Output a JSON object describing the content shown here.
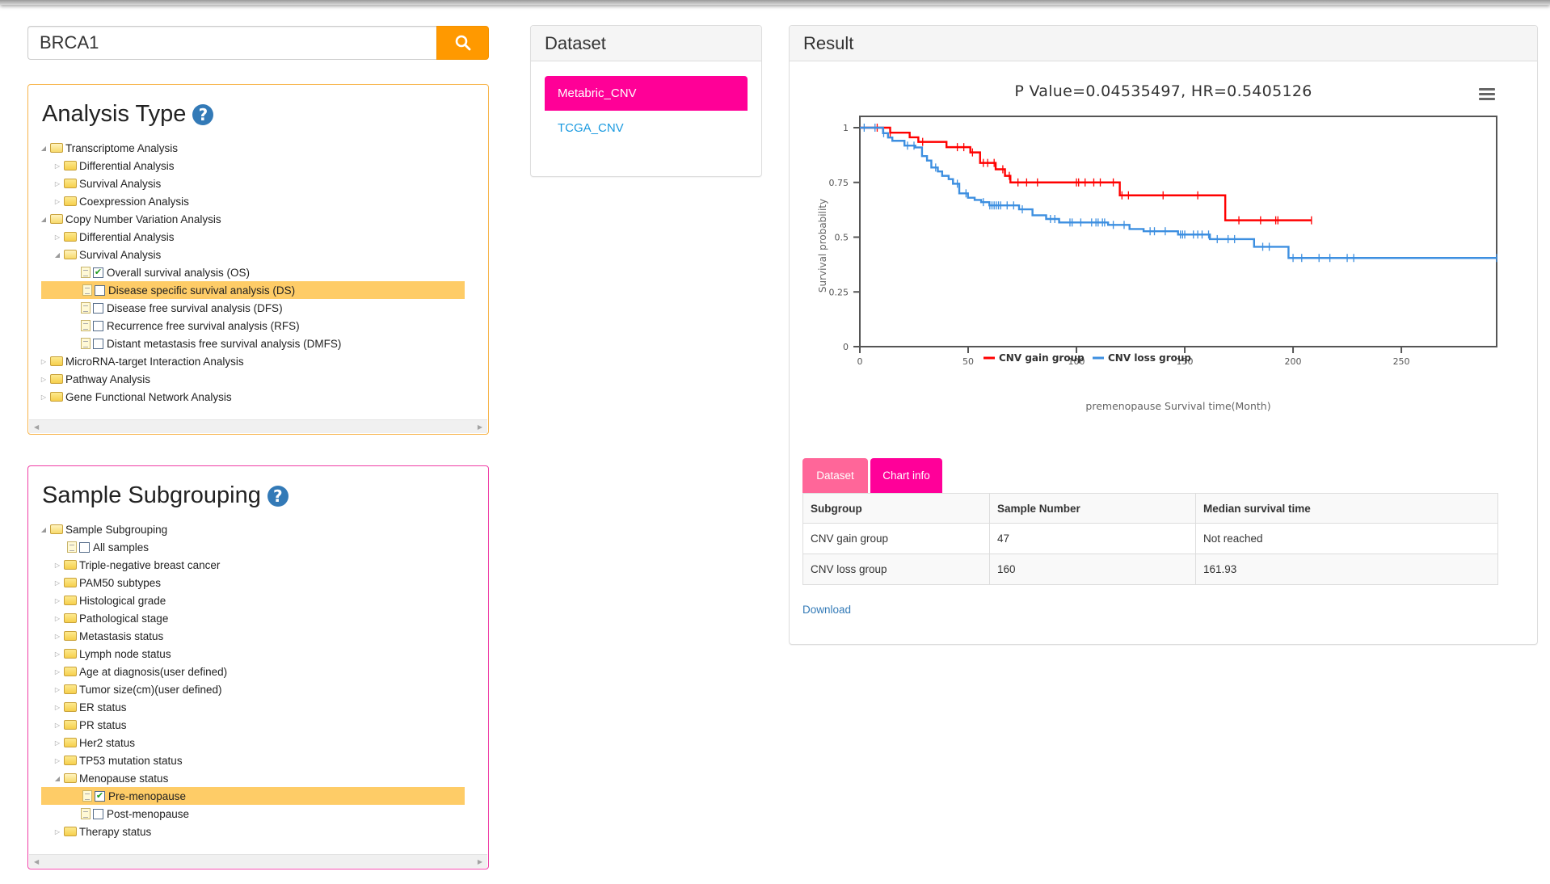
{
  "search": {
    "value": "BRCA1",
    "button_icon": "search-icon"
  },
  "analysis_panel": {
    "title": "Analysis Type",
    "help_icon": "?",
    "tree": [
      {
        "label": "Transcriptome Analysis",
        "level": 0,
        "type": "folder",
        "expanded": true
      },
      {
        "label": "Differential Analysis",
        "level": 1,
        "type": "folder",
        "expanded": false
      },
      {
        "label": "Survival Analysis",
        "level": 1,
        "type": "folder",
        "expanded": false
      },
      {
        "label": "Coexpression Analysis",
        "level": 1,
        "type": "folder",
        "expanded": false
      },
      {
        "label": "Copy Number Variation Analysis",
        "level": 0,
        "type": "folder",
        "expanded": true
      },
      {
        "label": "Differential Analysis",
        "level": 1,
        "type": "folder",
        "expanded": false
      },
      {
        "label": "Survival Analysis",
        "level": 1,
        "type": "folder",
        "expanded": true
      },
      {
        "label": "Overall survival analysis (OS)",
        "level": 2,
        "type": "leaf",
        "checked": true,
        "selected": false
      },
      {
        "label": "Disease specific survival analysis (DS)",
        "level": 2,
        "type": "leaf",
        "checked": false,
        "selected": true
      },
      {
        "label": "Disease free survival analysis (DFS)",
        "level": 2,
        "type": "leaf",
        "checked": false,
        "selected": false
      },
      {
        "label": "Recurrence free survival analysis (RFS)",
        "level": 2,
        "type": "leaf",
        "checked": false,
        "selected": false
      },
      {
        "label": "Distant metastasis free survival analysis (DMFS)",
        "level": 2,
        "type": "leaf",
        "checked": false,
        "selected": false
      },
      {
        "label": "MicroRNA-target Interaction Analysis",
        "level": 0,
        "type": "folder",
        "expanded": false
      },
      {
        "label": "Pathway Analysis",
        "level": 0,
        "type": "folder",
        "expanded": false
      },
      {
        "label": "Gene Functional Network Analysis",
        "level": 0,
        "type": "folder",
        "expanded": false
      }
    ]
  },
  "sample_panel": {
    "title": "Sample Subgrouping",
    "help_icon": "?",
    "tree": [
      {
        "label": "Sample Subgrouping",
        "level": 0,
        "type": "folder",
        "expanded": true
      },
      {
        "label": "All samples",
        "level": 1,
        "type": "leaf",
        "checked": false,
        "selected": false
      },
      {
        "label": "Triple-negative breast cancer",
        "level": 1,
        "type": "folder",
        "expanded": false
      },
      {
        "label": "PAM50 subtypes",
        "level": 1,
        "type": "folder",
        "expanded": false
      },
      {
        "label": "Histological grade",
        "level": 1,
        "type": "folder",
        "expanded": false
      },
      {
        "label": "Pathological stage",
        "level": 1,
        "type": "folder",
        "expanded": false
      },
      {
        "label": "Metastasis status",
        "level": 1,
        "type": "folder",
        "expanded": false
      },
      {
        "label": "Lymph node status",
        "level": 1,
        "type": "folder",
        "expanded": false
      },
      {
        "label": "Age at diagnosis(user defined)",
        "level": 1,
        "type": "folder",
        "expanded": false
      },
      {
        "label": "Tumor size(cm)(user defined)",
        "level": 1,
        "type": "folder",
        "expanded": false
      },
      {
        "label": "ER status",
        "level": 1,
        "type": "folder",
        "expanded": false
      },
      {
        "label": "PR status",
        "level": 1,
        "type": "folder",
        "expanded": false
      },
      {
        "label": "Her2 status",
        "level": 1,
        "type": "folder",
        "expanded": false
      },
      {
        "label": "TP53 mutation status",
        "level": 1,
        "type": "folder",
        "expanded": false
      },
      {
        "label": "Menopause status",
        "level": 1,
        "type": "folder",
        "expanded": true
      },
      {
        "label": "Pre-menopause",
        "level": 2,
        "type": "leaf",
        "checked": true,
        "selected": true
      },
      {
        "label": "Post-menopause",
        "level": 2,
        "type": "leaf",
        "checked": false,
        "selected": false
      },
      {
        "label": "Therapy status",
        "level": 1,
        "type": "folder",
        "expanded": false
      }
    ]
  },
  "dataset_panel": {
    "title": "Dataset",
    "items": [
      {
        "label": "Metabric_CNV",
        "active": true
      },
      {
        "label": "TCGA_CNV",
        "active": false
      }
    ]
  },
  "result_panel": {
    "title": "Result",
    "menu_icon": "hamburger-menu-icon",
    "tabs": [
      {
        "label": "Dataset"
      },
      {
        "label": "Chart info"
      }
    ],
    "table": {
      "headers": [
        "Subgroup",
        "Sample Number",
        "Median survival time"
      ],
      "rows": [
        [
          "CNV gain group",
          "47",
          "Not reached"
        ],
        [
          "CNV loss group",
          "160",
          "161.93"
        ]
      ]
    },
    "download_label": "Download"
  },
  "colors": {
    "accent_orange": "#ff9900",
    "accent_pink": "#ff0097",
    "tab_light_pink": "#ff6699",
    "selected_row": "#fecc67",
    "gain": "#ff0000",
    "loss": "#3d8fe0"
  },
  "chart_data": {
    "type": "line",
    "subtype": "kaplan-meier step",
    "title": "P Value=0.04535497, HR=0.5405126",
    "xlabel": "premenopause Survival time(Month)",
    "ylabel": "Survival probability",
    "xlim": [
      0,
      294
    ],
    "ylim": [
      0,
      1
    ],
    "xticks": [
      0,
      50,
      100,
      150,
      200,
      250
    ],
    "yticks": [
      0,
      0.25,
      0.5,
      0.75,
      1
    ],
    "ytick_labels": [
      "0",
      "0.25",
      "0.5",
      "0.75",
      "1"
    ],
    "grid": false,
    "legend_position": "bottom-center",
    "series": [
      {
        "name": "CNV gain group",
        "color": "#ff0000",
        "steps": [
          [
            0,
            1.0
          ],
          [
            14,
            0.977
          ],
          [
            23,
            0.956
          ],
          [
            27,
            0.935
          ],
          [
            40,
            0.911
          ],
          [
            51,
            0.887
          ],
          [
            55.5,
            0.839
          ],
          [
            62.7,
            0.81
          ],
          [
            67,
            0.78
          ],
          [
            69.5,
            0.75
          ],
          [
            120,
            0.691
          ],
          [
            168.7,
            0.577
          ],
          [
            208.5,
            0.577
          ]
        ],
        "censored": [
          8,
          14,
          29,
          45,
          48,
          52,
          57,
          59,
          62,
          66,
          69,
          73,
          77,
          82,
          100,
          101,
          104,
          108,
          111,
          117,
          121,
          124,
          140,
          156,
          175,
          185,
          192,
          193,
          208.5
        ]
      },
      {
        "name": "CNV loss group",
        "color": "#3d8fe0",
        "steps": [
          [
            0,
            1.0
          ],
          [
            10.7,
            0.975
          ],
          [
            13,
            0.955
          ],
          [
            15,
            0.94
          ],
          [
            20.6,
            0.918
          ],
          [
            25.6,
            0.91
          ],
          [
            28.7,
            0.87
          ],
          [
            31,
            0.85
          ],
          [
            33,
            0.818
          ],
          [
            36,
            0.8
          ],
          [
            38,
            0.78
          ],
          [
            41,
            0.765
          ],
          [
            43,
            0.744
          ],
          [
            45.9,
            0.7
          ],
          [
            49.9,
            0.68
          ],
          [
            53,
            0.67
          ],
          [
            56,
            0.66
          ],
          [
            59.8,
            0.645
          ],
          [
            73.5,
            0.627
          ],
          [
            79.7,
            0.6
          ],
          [
            86,
            0.583
          ],
          [
            92,
            0.567
          ],
          [
            114.6,
            0.556
          ],
          [
            124.5,
            0.537
          ],
          [
            131,
            0.527
          ],
          [
            146.9,
            0.512
          ],
          [
            161.6,
            0.491
          ],
          [
            182,
            0.456
          ],
          [
            197.9,
            0.405
          ],
          [
            294,
            0.405
          ]
        ],
        "censored": [
          2,
          7,
          11,
          22,
          25,
          35,
          45,
          49,
          57,
          60,
          61,
          62,
          63,
          64,
          65,
          68,
          71,
          75,
          88,
          90,
          97,
          98,
          102,
          107,
          109,
          110,
          112,
          113,
          117,
          122,
          134,
          136,
          141,
          148,
          149,
          150,
          154,
          156,
          158,
          161,
          165,
          170,
          173,
          186,
          189,
          200,
          204,
          212,
          217,
          225,
          228,
          294
        ]
      }
    ]
  }
}
